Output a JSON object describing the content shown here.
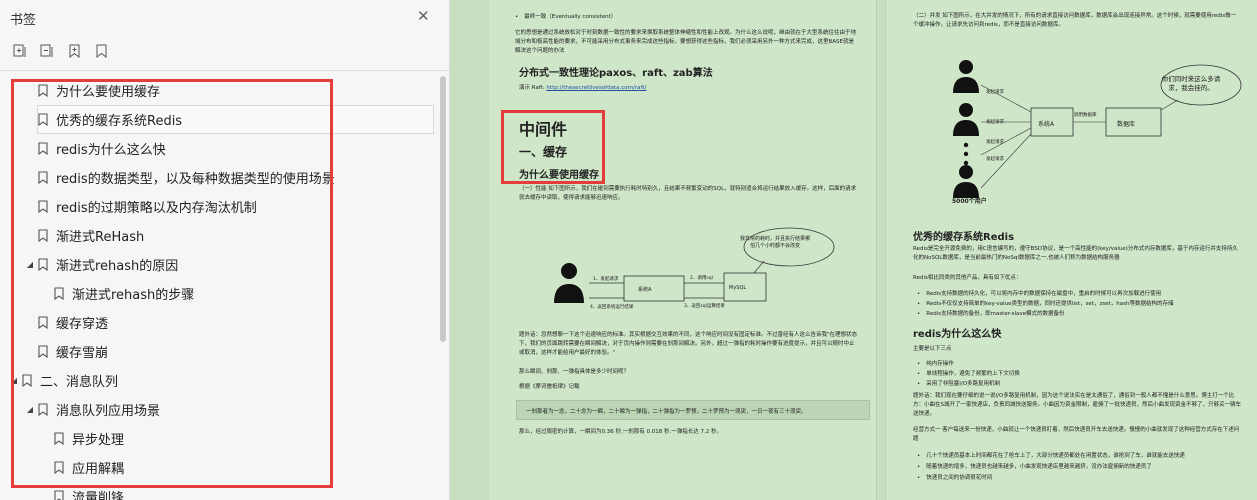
{
  "sidebar": {
    "title": "书签",
    "close_icon": "close-icon",
    "toolbar": [
      "expand-all-icon",
      "collapse-all-icon",
      "add-bookmark-icon",
      "bookmark-icon"
    ],
    "items": [
      {
        "label": "为什么要使用缓存",
        "level": 1,
        "caret": ""
      },
      {
        "label": "优秀的缓存系统Redis",
        "level": 1,
        "caret": "",
        "selected": true
      },
      {
        "label": "redis为什么这么快",
        "level": 1,
        "caret": ""
      },
      {
        "label": "redis的数据类型，以及每种数据类型的使用场景",
        "level": 1,
        "caret": ""
      },
      {
        "label": "redis的过期策略以及内存淘汰机制",
        "level": 1,
        "caret": ""
      },
      {
        "label": "渐进式ReHash",
        "level": 1,
        "caret": ""
      },
      {
        "label": "渐进式rehash的原因",
        "level": 1,
        "caret": "◢"
      },
      {
        "label": "渐进式rehash的步骤",
        "level": 2,
        "caret": ""
      },
      {
        "label": "缓存穿透",
        "level": 1,
        "caret": ""
      },
      {
        "label": "缓存雪崩",
        "level": 1,
        "caret": ""
      },
      {
        "label": "二、消息队列",
        "level": 0,
        "caret": "◢"
      },
      {
        "label": "消息队列应用场景",
        "level": 1,
        "caret": "◢"
      },
      {
        "label": "异步处理",
        "level": 2,
        "caret": ""
      },
      {
        "label": "应用解耦",
        "level": 2,
        "caret": ""
      },
      {
        "label": "流量削锋",
        "level": 2,
        "caret": ""
      }
    ]
  },
  "doc": {
    "left": {
      "bullet1": "最终一致（Eventually consistent）",
      "para1": "它的思想是通过系统放松对于时刻数据一致性的要求来换取系统整体伸缩性和性能上改观。为什么这么说呢，继由就在于大型系统往往由于地域分布和极高性能的要求，不可能采用分布式事务来完成这些指标，要想获得这些指标，我们必须采用另外一种方式来完成，这里BASE就是解决这个问题的办法",
      "h_consistency": "分布式一致性理论paxos、raft、zab算法",
      "demo_prefix": "演示 Raft:",
      "demo_link": "http://thesecretlivesofdata.com/raft/",
      "h_middleware": "中间件",
      "h_cache": "一、缓存",
      "h_why_cache": "为什么要使用缓存",
      "para2": "（一）性能 如下图所示，我们在碰到需要执行耗时特别久，且结果不频繁变动的SQL，就特别适合将运行结果放入缓存。这样，后面的请求就去缓存中读取，使得请求能够迅速响应。",
      "diagram1": {
        "bubble": "我非常的耗时，并且执行结果哪怕几个小时都不会改变",
        "box_system": "系统A",
        "box_mysql": "MySQL",
        "step1": "1、发起请求",
        "step2": "2、调用sql",
        "step3": "3、返回sql运算结果",
        "step4": "4、返回系统运行结果"
      },
      "para3": "题外话：忽然想聊一下这个迅速响应的标准。其实根据交互效果的不同，这个响应时间没有固定标准。不过曾经有人这么告诉我\"在理想状态下，我们的页面跳转需要在瞬间解决，对于页内操作则需要在刹那间解决。另外，超过一弹指的耗时操作要有进度提示，并且可以随时中止或取消，这样才能给用户最好的体验。\"",
      "para4": "那么瞬间、刹那、一弹指具体是多少时间呢？",
      "para5": "根据《摩诃僧祇律》记载",
      "quote": "一刹那者为一念，二十念为一瞬，二十瞬为一弹指，二十弹指为一罗预，二十罗预为一须臾，一日一夜有三十须臾。",
      "para6": "那么，经过周密的计算，一瞬间为0.36 秒,一刹那有 0.018 秒.一弹指长达 7.2 秒。"
    },
    "right": {
      "para1": "（二）并发 如下图所示，在大并发的情况下，所有的请求直接访问数据库，数据库会出现连接异常。这个时候，就需要使用redis做一个缓冲操作，让请求先访问到redis，而不是直接访问数据库。",
      "diagram2": {
        "bubble": "你们同时来这么多请求，我会挂的。",
        "box_system": "系统A",
        "box_db": "数据库",
        "req_labels": [
          "发起请求",
          "发起请求",
          "发起请求",
          "发起请求"
        ],
        "call_db": "调用数据库",
        "users": "5000个用户"
      },
      "h_redis": "优秀的缓存系统Redis",
      "para2": "Redis是完全开源免费的，用C语言编写的，遵守BSD协议，是一个高性能的(key/value)分布式内存数据库，基于内存运行并支持持久化的NoSQL数据库，是当前最热门的NoSql数据库之一,也被人们称为数据结构服务器",
      "para3": "Redis相比同类的其他产品，具有如下优点：",
      "bullets1": [
        "Redis支持数据的持久化，可以将内存中的数据保持在磁盘中，重启的时候可以再次加载进行使用",
        "Redis不仅仅支持简单的key-value类型的数据，同时还提供list，set，zset，hash等数据结构的存储",
        "Redis支持数据的备份，即master-slave模式的数据备份"
      ],
      "h_fast": "redis为什么这么快",
      "para4": "主要是以下三点",
      "bullets2": [
        "纯内存操作",
        "单线程操作，避免了频繁的上下文切换",
        "采用了非阻塞I/O多路复用机制"
      ],
      "para5": "题外话：我们现在要仔细的说一说I/O多路复用机制，因为这个说法实在是太通俗了，通俗到一般人都不懂是什么意思。博主打一个比方：小曲在S城开了一家快递店，负责同城快送服务。小曲因为资金限制，雇佣了一批快递员，然后小曲发现资金不够了，只够买一辆车送快递。",
      "para6": "经营方式一 客户每送来一份快递，小曲就让一个快递员盯着，然后快递员开车去送快递。慢慢的小曲就发现了这种经营方式存在下述问题",
      "bullets3": [
        "几十个快递员基本上时间都花在了抢车上了，大部分快递员都处在闲置状态，谁抢到了车，谁就能去送快递",
        "随着快递的增多，快递员也越来越多，小曲发现快递店里越来越挤，没办法雇佣新的快递员了",
        "快递员之间的协调很花时间"
      ]
    }
  }
}
